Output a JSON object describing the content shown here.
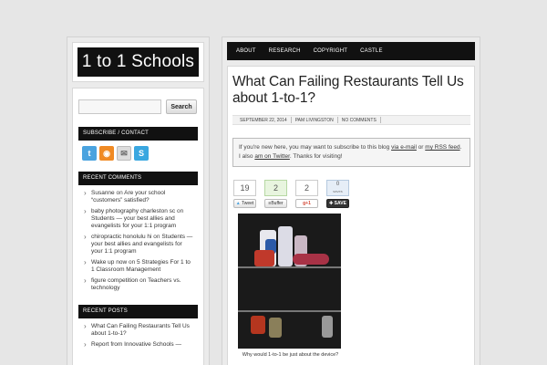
{
  "site": {
    "logo": "1 to 1 Schools"
  },
  "search": {
    "placeholder": "",
    "button": "Search"
  },
  "subscribe": {
    "title": "SUBSCRIBE / CONTACT",
    "icons": [
      "twitter-icon",
      "rss-icon",
      "mail-icon",
      "skype-icon"
    ]
  },
  "recent_comments": {
    "title": "RECENT COMMENTS",
    "items": [
      {
        "author": "Susanne",
        "on": "on",
        "post": "Are your school “customers” satisfied?"
      },
      {
        "author": "baby photography charleston sc",
        "on": "on",
        "post": "Students — your best allies and evangelists for your 1:1 program"
      },
      {
        "author": "chiropractic honolulu hi",
        "on": "on",
        "post": "Students — your best allies and evangelists for your 1:1 program"
      },
      {
        "author": "Wake up now",
        "on": "on",
        "post": "5 Strategies For 1 to 1 Classroom Management"
      },
      {
        "author": "figure competition",
        "on": "on",
        "post": "Teachers vs. technology"
      }
    ]
  },
  "recent_posts": {
    "title": "RECENT POSTS",
    "items": [
      "What Can Failing Restaurants Tell Us about 1-to-1?",
      "Report from Innovative Schools —"
    ]
  },
  "nav": {
    "items": [
      "ABOUT",
      "RESEARCH",
      "COPYRIGHT",
      "CASTLE"
    ]
  },
  "post": {
    "title": "What Can Failing Restaurants Tell Us about 1-to-1?",
    "date": "SEPTEMBER 22, 2014",
    "author": "PAM LIVINGSTON",
    "comments": "NO COMMENTS",
    "notice": {
      "text1": "If you're new here, you may want to subscribe to this blog ",
      "link1": "via e-mail",
      "text2": " or ",
      "link2": "my RSS feed",
      "text3": ". I also ",
      "link3": "am on Twitter",
      "text4": ". Thanks for visiting!"
    },
    "caption": "Why would 1-to-1 be just about the device?"
  },
  "shares": [
    {
      "count": "19",
      "label": "Tweet"
    },
    {
      "count": "2",
      "label": "Buffer"
    },
    {
      "count": "2",
      "label": "+1"
    },
    {
      "count": "0",
      "sub": "saves",
      "label": "SAVE"
    }
  ]
}
